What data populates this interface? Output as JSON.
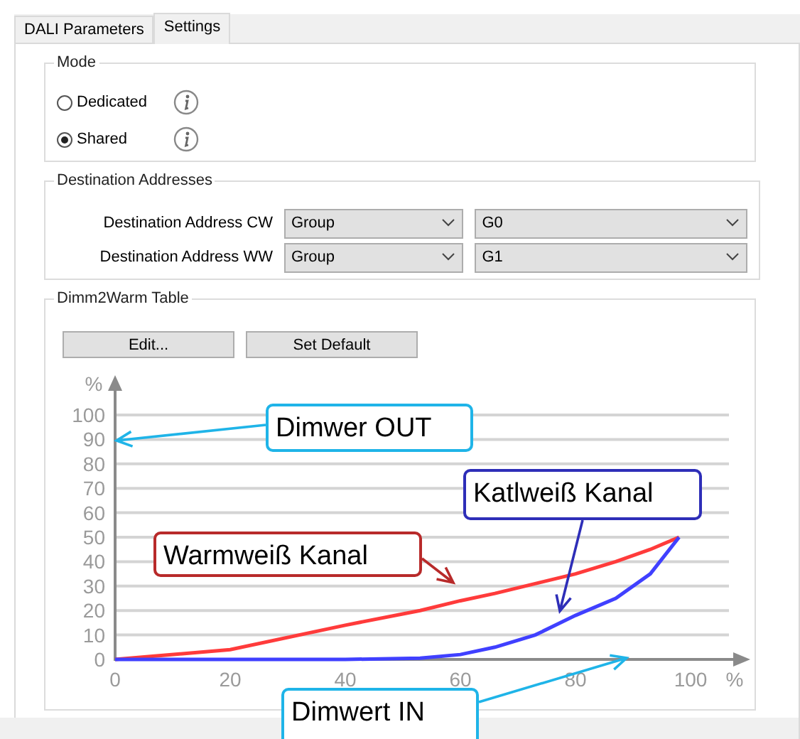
{
  "tabs": [
    {
      "label": "DALI Parameters",
      "selected": false
    },
    {
      "label": "Settings",
      "selected": true
    }
  ],
  "mode": {
    "title": "Mode",
    "options": [
      {
        "label": "Dedicated",
        "selected": false
      },
      {
        "label": "Shared",
        "selected": true
      }
    ]
  },
  "destination": {
    "title": "Destination Addresses",
    "rows": [
      {
        "label": "Destination Address CW",
        "type": "Group",
        "address": "G0"
      },
      {
        "label": "Destination Address WW",
        "type": "Group",
        "address": "G1"
      }
    ]
  },
  "dimm2warm": {
    "title": "Dimm2Warm Table",
    "buttons": [
      "Edit...",
      "Set Default"
    ],
    "chart_data": {
      "type": "line",
      "xlabel": "%",
      "ylabel": "%",
      "x": [
        0,
        20,
        40,
        53,
        60,
        66,
        73,
        80,
        87,
        93,
        98
      ],
      "series": [
        {
          "name": "Warmweiß Kanal",
          "color": "#ff3b3b",
          "values": [
            0,
            4,
            14,
            20,
            24,
            27,
            31,
            35,
            40,
            45,
            50
          ]
        },
        {
          "name": "Katlweiß Kanal",
          "color": "#4040ff",
          "values": [
            0,
            0,
            0,
            0.5,
            2,
            5,
            10,
            18,
            25,
            35,
            50
          ]
        }
      ],
      "xlim": [
        0,
        100
      ],
      "ylim": [
        0,
        100
      ],
      "grid": true,
      "xticks": [
        0,
        20,
        40,
        60,
        80,
        100
      ],
      "yticks": [
        0,
        10,
        20,
        30,
        40,
        50,
        60,
        70,
        80,
        90,
        100
      ]
    },
    "callouts": [
      {
        "text": "Dimwer OUT",
        "color": "#1fb4e8"
      },
      {
        "text": "Dimwert IN",
        "color": "#1fb4e8"
      }
    ]
  }
}
